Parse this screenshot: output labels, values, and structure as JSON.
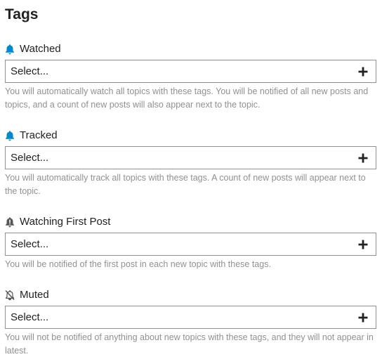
{
  "page": {
    "title": "Tags"
  },
  "sections": [
    {
      "label": "Watched",
      "icon": "bell-icon",
      "icon_color": "#0088cc",
      "select": {
        "placeholder": "Select..."
      },
      "help": "You will automatically watch all topics with these tags. You will be notified of all new posts and topics, and a count of new posts will also appear next to the topic."
    },
    {
      "label": "Tracked",
      "icon": "bell-icon",
      "icon_color": "#0088cc",
      "select": {
        "placeholder": "Select..."
      },
      "help": "You will automatically track all topics with these tags. A count of new posts will appear next to the topic."
    },
    {
      "label": "Watching First Post",
      "icon": "bell-exclamation-icon",
      "icon_color": "#555555",
      "select": {
        "placeholder": "Select..."
      },
      "help": "You will be notified of the first post in each new topic with these tags."
    },
    {
      "label": "Muted",
      "icon": "bell-slash-icon",
      "icon_color": "#555555",
      "select": {
        "placeholder": "Select..."
      },
      "help": "You will not be notified of anything about new topics with these tags, and they will not appear in latest."
    }
  ]
}
